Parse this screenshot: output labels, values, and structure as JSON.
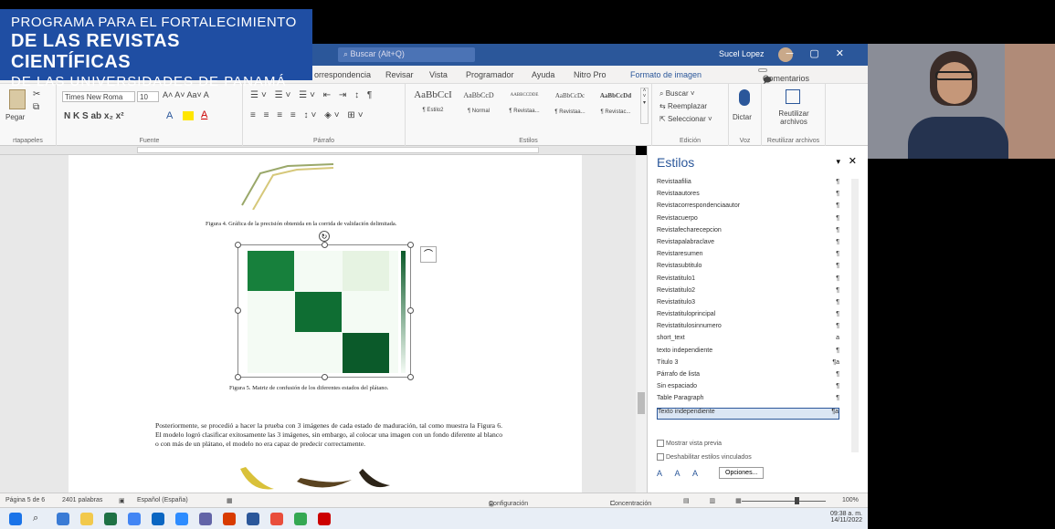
{
  "banner": {
    "line1": "PROGRAMA PARA EL FORTALECIMIENTO",
    "line2": "DE LAS REVISTAS CIENTÍFICAS",
    "line3": "DE LAS UNIVERSIDADES DE PANAMÁ"
  },
  "titlebar": {
    "search_placeholder": "Buscar (Alt+Q)",
    "user": "Sucel Lopez"
  },
  "menu": [
    "orrespondencia",
    "Revisar",
    "Vista",
    "Programador",
    "Ayuda",
    "Nitro Pro",
    "Formato de imagen"
  ],
  "comments_button": "Comentarios",
  "ribbon": {
    "paste": "Pegar",
    "clipboard_label": "rtapapeles",
    "font_name": "Times New Roma",
    "font_size": "10",
    "font_label": "Fuente",
    "paragraph_label": "Párrafo",
    "styles": [
      {
        "preview": "AaBbCcI",
        "name": "¶ Estilo2"
      },
      {
        "preview": "AaBbCcD",
        "name": "¶ Normal"
      },
      {
        "preview": "AABBCCDDE",
        "name": "¶ Revistaa..."
      },
      {
        "preview": "AaBbCcDc",
        "name": "¶ Revistaa..."
      },
      {
        "preview": "AaBbCcDd",
        "name": "¶ Revistac..."
      }
    ],
    "styles_label": "Estilos",
    "find": "Buscar",
    "replace": "Reemplazar",
    "select": "Seleccionar",
    "edit_label": "Edición",
    "dictate": "Dictar",
    "voice_label": "Voz",
    "reuse": "Reutilizar archivos",
    "reuse_label": "Reutilizar archivos"
  },
  "document": {
    "figure4_caption": "Figura 4. Gráfica de la precisión obtenida en la corrida de validación delimitada.",
    "figure5_caption": "Figura 5. Matriz de confusión de los diferentes estados del plátano.",
    "paragraph": "Posteriormente, se procedió a hacer la prueba con 3 imágenes de cada estado de maduración, tal como muestra la Figura 6. El modelo logró clasificar exitosamente las 3 imágenes, sin embargo, al colocar una imagen con un fondo diferente al blanco o con más de un plátano, el modelo no era capaz de predecir correctamente."
  },
  "styles_panel": {
    "title": "Estilos",
    "items": [
      {
        "name": "Revistaafilia",
        "sym": "¶"
      },
      {
        "name": "Revistaautores",
        "sym": "¶"
      },
      {
        "name": "Revistacorrespondenciaautor",
        "sym": "¶"
      },
      {
        "name": "Revistacuerpo",
        "sym": "¶"
      },
      {
        "name": "Revistafecharecepcion",
        "sym": "¶"
      },
      {
        "name": "Revistapalabraclave",
        "sym": "¶"
      },
      {
        "name": "Revistaresumen",
        "sym": "¶"
      },
      {
        "name": "Revistasubtitulo",
        "sym": "¶"
      },
      {
        "name": "Revistatitulo1",
        "sym": "¶"
      },
      {
        "name": "Revistatitulo2",
        "sym": "¶"
      },
      {
        "name": "Revistatitulo3",
        "sym": "¶"
      },
      {
        "name": "Revistatituloprincipal",
        "sym": "¶"
      },
      {
        "name": "Revistatitulosinnumero",
        "sym": "¶"
      },
      {
        "name": "short_text",
        "sym": "a"
      },
      {
        "name": "texto independiente",
        "sym": "¶"
      },
      {
        "name": "Título 3",
        "sym": "¶a"
      },
      {
        "name": "Párrafo de lista",
        "sym": "¶"
      },
      {
        "name": "Sin espaciado",
        "sym": "¶"
      },
      {
        "name": "Table Paragraph",
        "sym": "¶"
      },
      {
        "name": "Texto independiente",
        "sym": "¶a"
      }
    ],
    "show_preview": "Mostrar vista previa",
    "disable_linked": "Deshabilitar estilos vinculados",
    "options": "Opciones..."
  },
  "status": {
    "page": "Página 5 de 6",
    "words": "2401 palabras",
    "language": "Español (España)",
    "display_settings": "Configuración de visualización",
    "focus": "Concentración",
    "zoom": "100%"
  },
  "clock": {
    "time": "09:38 a. m.",
    "date": "14/11/2022"
  },
  "colors": {
    "word_blue": "#2b579a",
    "banner_blue": "#1f4ea3",
    "matrix_dark": "#0b5a2a"
  }
}
